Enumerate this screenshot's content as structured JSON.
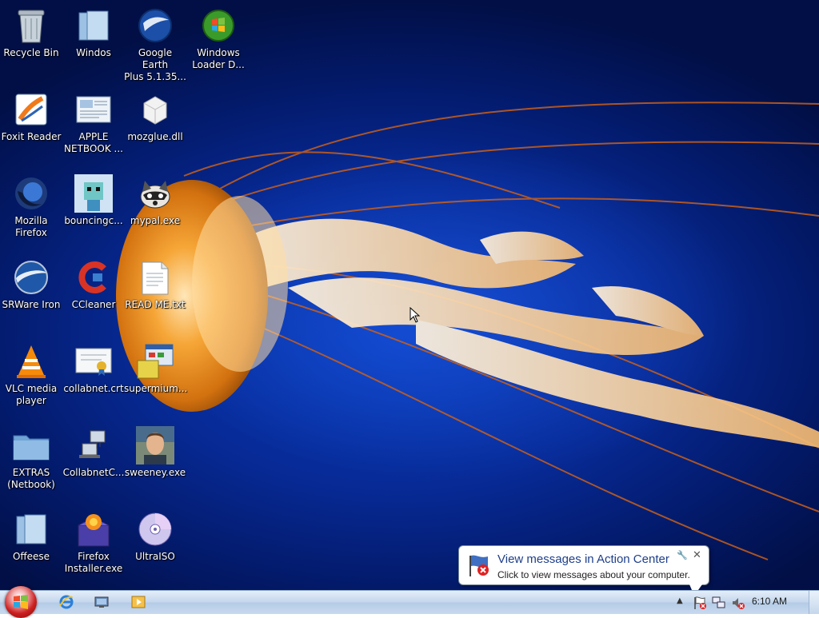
{
  "desktop": {
    "icons": [
      {
        "id": "recycle-bin",
        "label": "Recycle Bin"
      },
      {
        "id": "windos",
        "label": "Windos"
      },
      {
        "id": "google-earth",
        "label": "Google Earth\nPlus 5.1.35..."
      },
      {
        "id": "windows-loader",
        "label": "Windows\nLoader D..."
      },
      {
        "id": "foxit-reader",
        "label": "Foxit Reader"
      },
      {
        "id": "apple-netbook",
        "label": "APPLE\nNETBOOK ..."
      },
      {
        "id": "mozglue",
        "label": "mozglue.dll"
      },
      {
        "id": "mozilla-firefox",
        "label": "Mozilla\nFirefox"
      },
      {
        "id": "bouncingc",
        "label": "bouncingc..."
      },
      {
        "id": "mypal",
        "label": "mypal.exe"
      },
      {
        "id": "srware-iron",
        "label": "SRWare Iron"
      },
      {
        "id": "ccleaner",
        "label": "CCleaner"
      },
      {
        "id": "readme",
        "label": "READ ME.txt"
      },
      {
        "id": "vlc",
        "label": "VLC media\nplayer"
      },
      {
        "id": "collabnet-crt",
        "label": "collabnet.crt"
      },
      {
        "id": "supermium",
        "label": "supermium..."
      },
      {
        "id": "extras",
        "label": "EXTRAS\n(Netbook)"
      },
      {
        "id": "collabnetc",
        "label": "CollabnetC..."
      },
      {
        "id": "sweeney",
        "label": "sweeney.exe"
      },
      {
        "id": "offeese",
        "label": "Offeese"
      },
      {
        "id": "firefox-installer",
        "label": "Firefox\nInstaller.exe"
      },
      {
        "id": "ultraiso",
        "label": "UltraISO"
      }
    ]
  },
  "notification": {
    "title": "View messages in Action Center",
    "body": "Click to view messages about your computer."
  },
  "taskbar": {
    "clock": "6:10 AM",
    "pinned": [
      "internet-explorer-icon",
      "explorer-icon",
      "media-player-icon"
    ]
  },
  "colors": {
    "taskbar": "#c3d6ec",
    "desktop": "#0a3fc0",
    "start": "#cc1f1f"
  }
}
